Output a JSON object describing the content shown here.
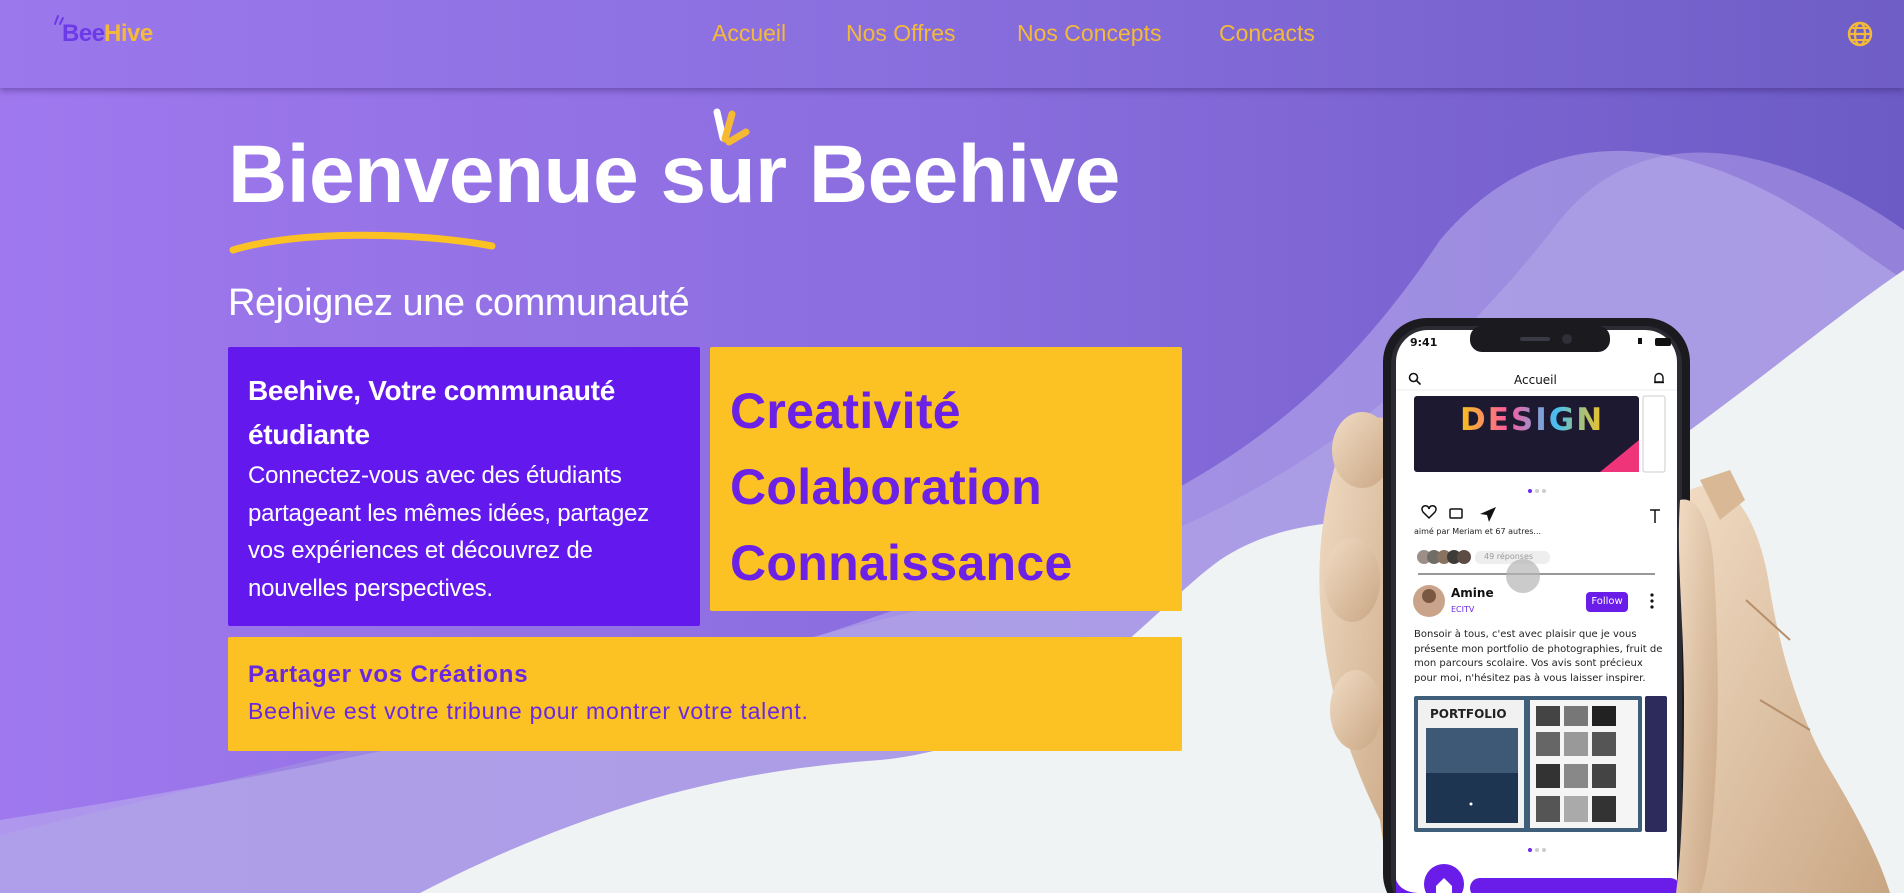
{
  "header": {
    "logo": {
      "part1": "Bee",
      "part2": "Hive"
    },
    "nav": [
      "Accueil",
      "Nos Offres",
      "Nos Concepts",
      "Concacts"
    ]
  },
  "hero": {
    "title": "Bienvenue sur Beehive",
    "subtitle": "Rejoignez une communauté"
  },
  "card_community": {
    "heading": "Beehive, Votre communauté étudiante",
    "body": "Connectez-vous avec des étudiants partageant les mêmes idées, partagez vos expériences et découvrez de nouvelles perspectives."
  },
  "card_values": [
    "Creativité",
    "Colaboration",
    "Connaissance"
  ],
  "card_share": {
    "heading": "Partager vos Créations",
    "body": "Beehive est votre tribune pour montrer votre talent."
  },
  "phone": {
    "time": "9:41",
    "screen_title": "Accueil",
    "banner_text": "DESIGN",
    "liked_by": "aimé par Meriam et 67 autres...",
    "replies": "49 réponses",
    "post_user": "Amine",
    "post_tag": "ECITV",
    "follow_label": "Follow",
    "post_text": "Bonsoir à tous, c'est avec plaisir que je vous présente mon portfolio de photographies, fruit de mon parcours scolaire. Vos avis sont précieux pour moi, n'hésitez pas à vous laisser inspirer.",
    "portfolio_label": "PORTFOLIO"
  },
  "colors": {
    "brand_purple": "#6318ee",
    "brand_yellow": "#fcc122",
    "nav_link": "#f3ba3a",
    "background_light": "#f0f3f3"
  },
  "icons": [
    "globe-icon",
    "search-icon",
    "bell-icon",
    "heart-icon",
    "comment-icon",
    "send-icon",
    "pin-icon",
    "more-icon",
    "home-icon"
  ]
}
